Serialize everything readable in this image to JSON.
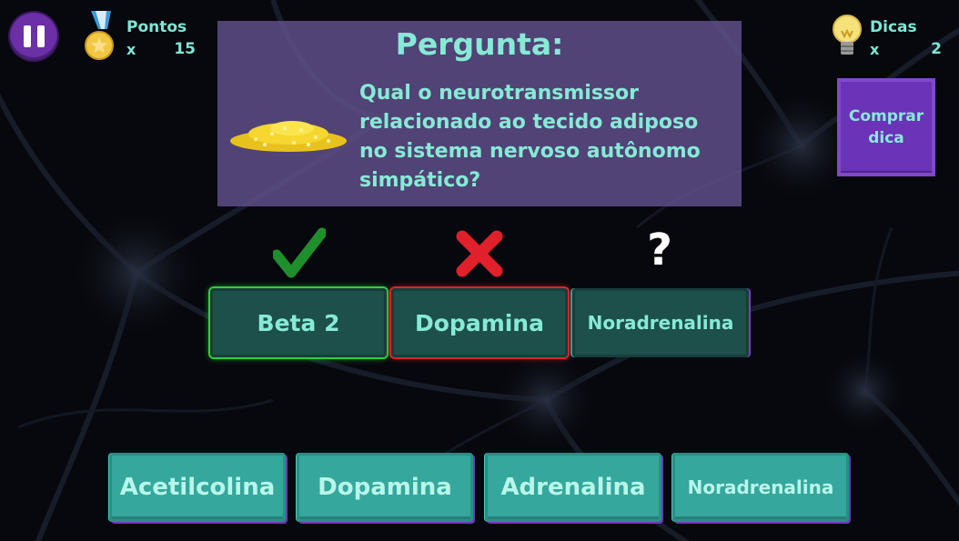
{
  "hud": {
    "points_label": "Pontos",
    "points_multiplier": "x",
    "points_value": "15",
    "hints_label": "Dicas",
    "hints_multiplier": "x",
    "hints_value": "2",
    "buy_hint_label": "Comprar dica"
  },
  "question": {
    "title": "Pergunta:",
    "text": "Qual o neurotransmissor relacionado ao tecido adiposo no sistema nervoso autônomo simpático?"
  },
  "answer_slots": [
    {
      "label": "Beta 2",
      "status": "correct"
    },
    {
      "label": "Dopamina",
      "status": "wrong"
    },
    {
      "label": "Noradrenalina",
      "status": "unknown"
    }
  ],
  "status_marks": {
    "unknown_mark": "?"
  },
  "options": [
    {
      "label": "Acetilcolina"
    },
    {
      "label": "Dopamina"
    },
    {
      "label": "Adrenalina"
    },
    {
      "label": "Noradrenalina"
    }
  ],
  "icons": {
    "pause": "pause-icon",
    "points": "medal-icon",
    "hints": "lightbulb-icon",
    "question": "gold-pile-icon",
    "correct": "checkmark-icon",
    "wrong": "x-icon"
  },
  "colors": {
    "accent_text": "#86ead6",
    "panel": "#62508c",
    "correct": "#28d23a",
    "wrong": "#e0202a",
    "option": "#35a79c",
    "slot": "#1d4f4b",
    "pause": "#6b2fa6"
  }
}
